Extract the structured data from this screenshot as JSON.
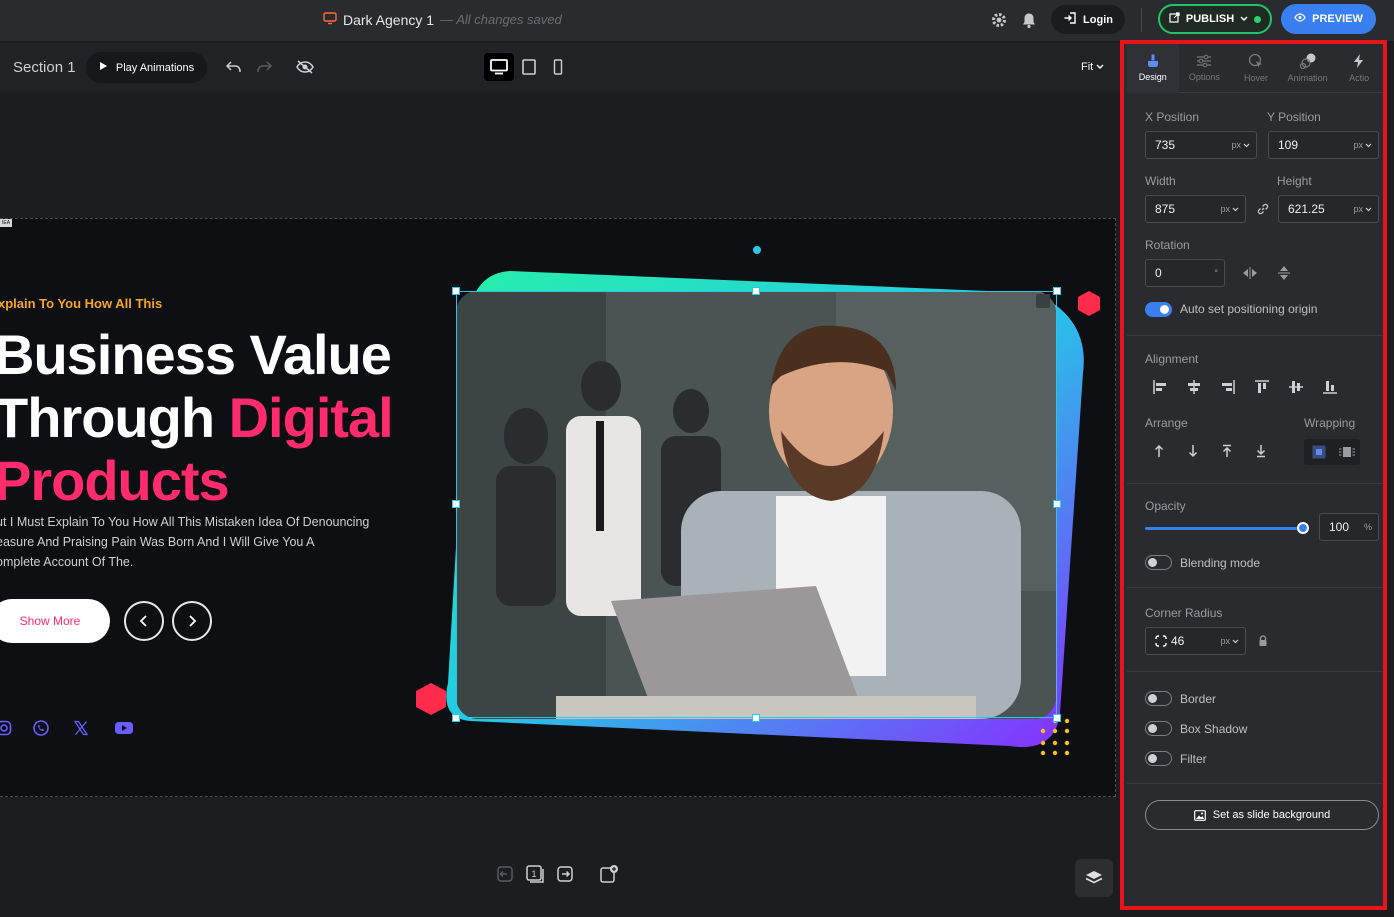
{
  "header": {
    "doc_name": "Dark Agency 1",
    "save_status": "— All changes saved",
    "login_label": "Login",
    "publish_label": "PUBLISH",
    "preview_label": "PREVIEW"
  },
  "toolbar": {
    "section_label": "Section 1",
    "play_label": "Play Animations",
    "zoom_label": "Fit"
  },
  "slide": {
    "tag": "IEA",
    "subtitle": "xplain To You How All This",
    "headline_line1": "Business Value",
    "headline_line2a": "Through",
    "headline_line2b": "Digital",
    "headline_line3": "Products",
    "paragraph_line1": "ut I Must Explain To You How All This Mistaken Idea Of Denouncing",
    "paragraph_line2": "easure And Praising Pain Was Born And I Will Give You A",
    "paragraph_line3": "omplete Account Of The.",
    "button_label": "Show More"
  },
  "panel": {
    "tabs": [
      {
        "label": "Design",
        "icon": "brush-icon"
      },
      {
        "label": "Options",
        "icon": "sliders-icon"
      },
      {
        "label": "Hover",
        "icon": "cursor-icon"
      },
      {
        "label": "Animation",
        "icon": "animation-icon"
      },
      {
        "label": "Actio",
        "icon": "bolt-icon"
      }
    ],
    "x_label": "X Position",
    "x_value": "735",
    "y_label": "Y Position",
    "y_value": "109",
    "width_label": "Width",
    "width_value": "875",
    "height_label": "Height",
    "height_value": "621.25",
    "unit": "px",
    "rotation_label": "Rotation",
    "rotation_value": "0",
    "rotation_unit": "°",
    "auto_origin_label": "Auto set positioning origin",
    "alignment_label": "Alignment",
    "arrange_label": "Arrange",
    "wrapping_label": "Wrapping",
    "opacity_label": "Opacity",
    "opacity_value": "100",
    "opacity_unit": "%",
    "opacity_level": 1.0,
    "blending_label": "Blending mode",
    "corner_radius_label": "Corner Radius",
    "corner_radius_value": "46",
    "border_label": "Border",
    "box_shadow_label": "Box Shadow",
    "filter_label": "Filter",
    "slide_bg_label": "Set as slide background"
  },
  "colors": {
    "accent_blue": "#3a7ff0",
    "publish_green": "#23c26b",
    "headline_pink": "#ff2b6d",
    "subtitle_orange": "#f5a623",
    "selection_cyan": "#2ec5e6",
    "highlight_red": "#e8131b"
  }
}
